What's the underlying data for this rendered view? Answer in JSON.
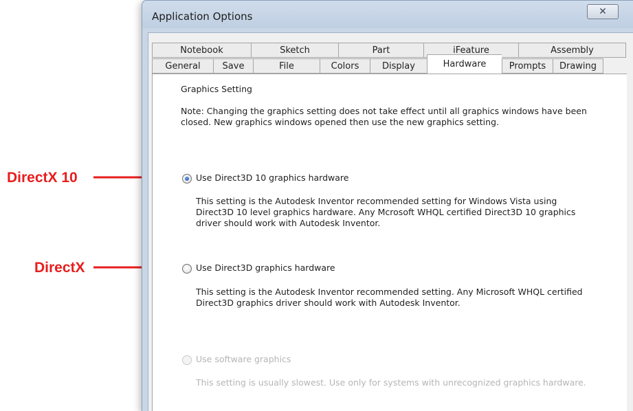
{
  "annotations": {
    "directx10": "DirectX 10",
    "directx": "DirectX",
    "color": "#e81d1d"
  },
  "dialog": {
    "title": "Application Options",
    "close_symbol": "✕",
    "tabs_row1": [
      "Notebook",
      "Sketch",
      "Part",
      "iFeature",
      "Assembly"
    ],
    "tabs_row2": [
      "General",
      "Save",
      "File",
      "Colors",
      "Display",
      "Hardware",
      "Prompts",
      "Drawing"
    ],
    "active_tab": "Hardware"
  },
  "hardware": {
    "section_label": "Graphics Setting",
    "note_line1": "Note: Changing the graphics setting does not take effect until all graphics windows have been",
    "note_line2": "closed.  New graphics windows opened then use the new graphics setting.",
    "options": [
      {
        "label": "Use Direct3D 10 graphics hardware",
        "selected": true,
        "enabled": true,
        "desc_lines": [
          "This setting is the Autodesk Inventor recommended setting for Windows Vista using",
          "Direct3D 10 level graphics hardware.  Any Mcrosoft WHQL certified Direct3D 10 graphics",
          "driver should work with Autodesk Inventor."
        ]
      },
      {
        "label": "Use Direct3D graphics hardware",
        "selected": false,
        "enabled": true,
        "desc_lines": [
          "This setting is the Autodesk Inventor recommended setting.  Any Microsoft WHQL certified",
          "Direct3D graphics driver should work with Autodesk Inventor."
        ]
      },
      {
        "label": "Use software graphics",
        "selected": false,
        "enabled": false,
        "desc_lines": [
          "This setting is usually slowest.  Use only for systems with unrecognized graphics hardware."
        ]
      }
    ]
  }
}
